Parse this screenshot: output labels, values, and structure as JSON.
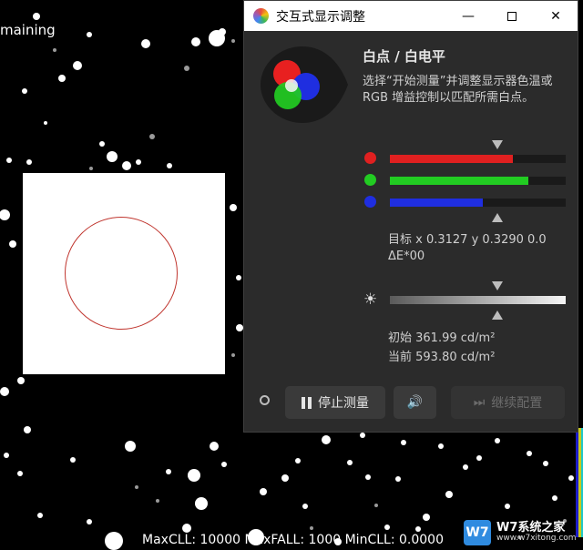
{
  "background": {
    "remaining_text": "maining",
    "hdr_info": "MaxCLL: 10000  MaxFALL: 1000  MinCLL: 0.0000"
  },
  "watermark": {
    "logo_text": "W7",
    "title": "W7系统之家",
    "url": "www.w7xitong.com"
  },
  "dialog": {
    "title": "交互式显示调整",
    "minimize_glyph": "—",
    "close_glyph": "✕",
    "heading": "白点 / 白电平",
    "description": "选择“开始测量”并调整显示器色温或 RGB 增益控制以匹配所需白点。",
    "rgb_bars": [
      {
        "name": "red",
        "color": "#e02020",
        "level": 0.7
      },
      {
        "name": "green",
        "color": "#22cc22",
        "level": 0.79
      },
      {
        "name": "blue",
        "color": "#1f2ee0",
        "level": 0.53
      }
    ],
    "target_text": "目标 x 0.3127 y 0.3290 0.0 ΔE*00",
    "luminance_initial": "初始 361.99 cd/m²",
    "luminance_current": "当前 593.80 cd/m²",
    "sun_glyph": "☀",
    "buttons": {
      "stop_label": "停止测量",
      "continue_label": "继续配置",
      "sound_glyph": "🔊",
      "continue_glyph": "⏭"
    },
    "icons": [
      "app-icon",
      "minimize-icon",
      "maximize-icon",
      "close-icon",
      "rgb-hero-icon",
      "sun-icon",
      "pause-icon",
      "speaker-icon",
      "skip-forward-icon",
      "status-ring-icon"
    ]
  }
}
